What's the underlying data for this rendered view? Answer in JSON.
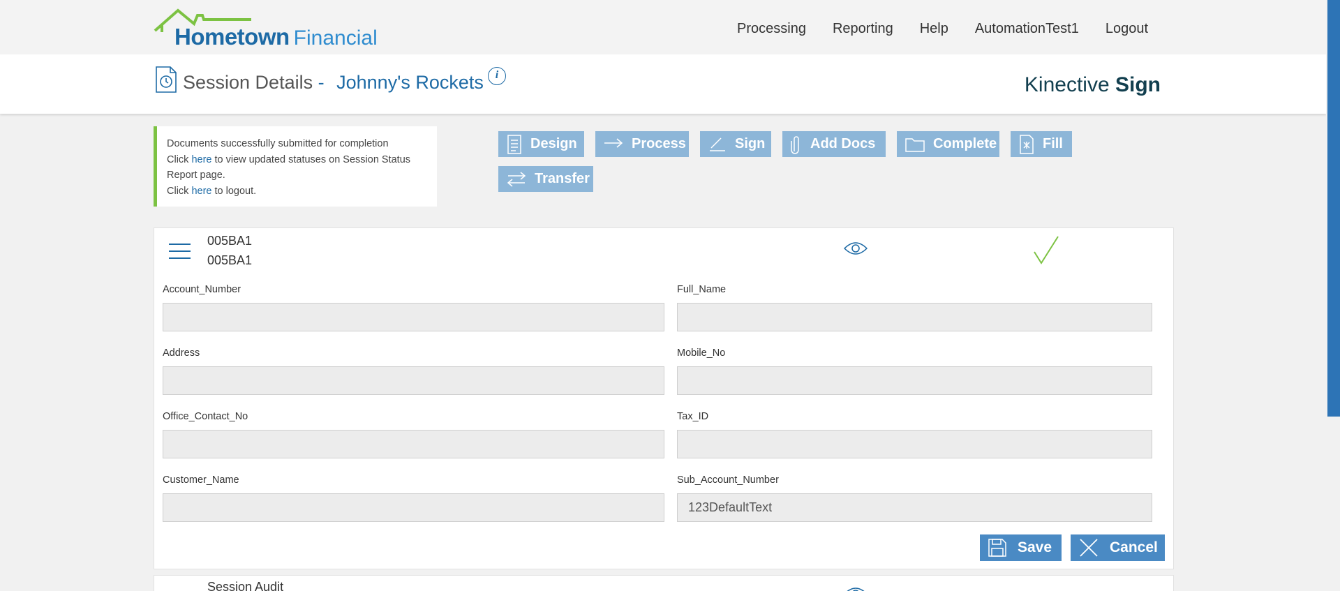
{
  "logo": {
    "main": "Hometown",
    "sub": "Financial"
  },
  "nav": [
    "Processing",
    "Reporting",
    "Help",
    "AutomationTest1",
    "Logout"
  ],
  "session": {
    "title": "Session Details",
    "separator": "-",
    "name": "Johnny's Rockets",
    "info": "i"
  },
  "brand": {
    "first": "Kinective",
    "second": "Sign"
  },
  "message": {
    "line1": "Documents successfully submitted for completion",
    "line2_pre": "Click ",
    "line2_link": "here",
    "line2_post": " to view updated statuses on Session Status",
    "line3": "Report page.",
    "line4_pre": "Click ",
    "line4_link": "here",
    "line4_post": " to logout."
  },
  "actions": {
    "design": "Design",
    "process": "Process",
    "sign": "Sign",
    "add_docs": "Add Docs",
    "complete": "Complete",
    "fill": "Fill",
    "transfer": "Transfer"
  },
  "document": {
    "id_line1": "005BA1",
    "id_line2": "005BA1"
  },
  "form": {
    "account_number": {
      "label": "Account_Number",
      "value": ""
    },
    "full_name": {
      "label": "Full_Name",
      "value": ""
    },
    "address": {
      "label": "Address",
      "value": ""
    },
    "mobile_no": {
      "label": "Mobile_No",
      "value": ""
    },
    "office_contact_no": {
      "label": "Office_Contact_No",
      "value": ""
    },
    "tax_id": {
      "label": "Tax_ID",
      "value": ""
    },
    "customer_name": {
      "label": "Customer_Name",
      "value": ""
    },
    "sub_account_number": {
      "label": "Sub_Account_Number",
      "value": "123DefaultText"
    }
  },
  "buttons": {
    "save": "Save",
    "cancel": "Cancel"
  },
  "audit": {
    "label": "Session Audit"
  },
  "colors": {
    "primary": "#1d6aa5",
    "button_light": "#8db6d8",
    "button_dark": "#4a8ac4",
    "success_green": "#7cc242",
    "scrollbar": "#2d74b6"
  }
}
